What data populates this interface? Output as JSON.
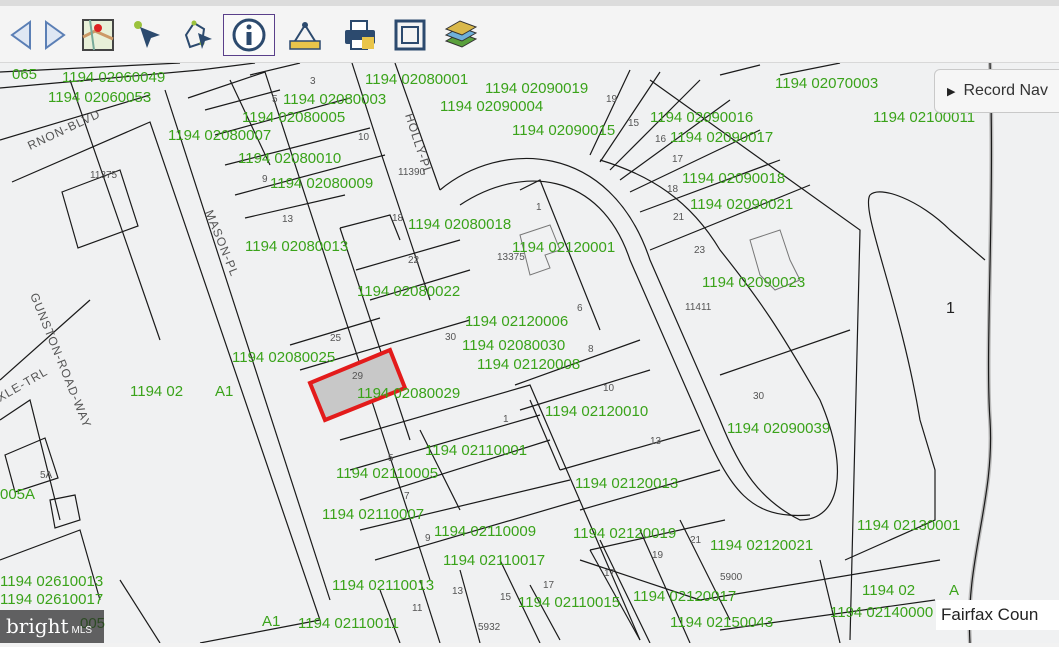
{
  "toolbar": {
    "items": [
      {
        "name": "back-arrow-icon"
      },
      {
        "name": "forward-arrow-icon"
      },
      {
        "name": "map-locate-icon"
      },
      {
        "name": "select-pointer-icon"
      },
      {
        "name": "select-polygon-icon"
      },
      {
        "name": "identify-info-icon"
      },
      {
        "name": "measure-icon"
      },
      {
        "name": "print-icon"
      },
      {
        "name": "full-extent-icon"
      },
      {
        "name": "layers-icon"
      }
    ],
    "active": "identify-info-icon"
  },
  "record_nav": {
    "label": "Record Nav"
  },
  "footer": {
    "county": "Fairfax Coun"
  },
  "logo": {
    "text": "bright",
    "suffix": "MLS"
  },
  "colors": {
    "parcel_label": "#3aa31a",
    "line": "#1a1a1a",
    "selected": "#e31b1b",
    "road_fill": "#f0f1f2"
  },
  "map": {
    "parcel_labels": [
      {
        "text": "1194 02060049"
      },
      {
        "text": "1194 02060053"
      },
      {
        "text": "1194 02080001"
      },
      {
        "text": "1194 02090019"
      },
      {
        "text": "1194 02090004"
      },
      {
        "text": "1194 02070003"
      },
      {
        "text": "1194 02080003"
      },
      {
        "text": "1194 02080007"
      },
      {
        "text": "1194 02080005"
      },
      {
        "text": "1194 02090015"
      },
      {
        "text": "1194 02090016"
      },
      {
        "text": "1194 02090017"
      },
      {
        "text": "1194 02100011"
      },
      {
        "text": "1194 02080010"
      },
      {
        "text": "1194 02080009"
      },
      {
        "text": "1194 02090018"
      },
      {
        "text": "1194 02090021"
      },
      {
        "text": "1194 02080018"
      },
      {
        "text": "1194 02080013"
      },
      {
        "text": "1194 02120001"
      },
      {
        "text": "1194 02080022"
      },
      {
        "text": "1194 02090023"
      },
      {
        "text": "1194 02120006"
      },
      {
        "text": "1194 02080030"
      },
      {
        "text": "1194 02080025"
      },
      {
        "text": "1194 02120008"
      },
      {
        "text": "1194 02"
      },
      {
        "text": "A1"
      },
      {
        "text": "1194 02080029"
      },
      {
        "text": "1194 02120010"
      },
      {
        "text": "1194 02090039"
      },
      {
        "text": "1194 02110001"
      },
      {
        "text": "1194 02110005"
      },
      {
        "text": "1194 02120013"
      },
      {
        "text": "1194 02110007"
      },
      {
        "text": "1194 02110009"
      },
      {
        "text": "1194 02120019"
      },
      {
        "text": "1194 02120021"
      },
      {
        "text": "1194 02130001"
      },
      {
        "text": "1194 02110017"
      },
      {
        "text": "1194 02610013"
      },
      {
        "text": "1194 02110013"
      },
      {
        "text": "1194 02"
      },
      {
        "text": "A"
      },
      {
        "text": "1194 02610017"
      },
      {
        "text": "1194 02110015"
      },
      {
        "text": "1194 02120017"
      },
      {
        "text": "1194 02140000"
      },
      {
        "text": "A1"
      },
      {
        "text": "1194 02110011"
      },
      {
        "text": "1194 02150043"
      },
      {
        "text": "005A"
      },
      {
        "text": "065"
      },
      {
        "text": "005"
      }
    ],
    "lot_numbers": [
      "3",
      "5",
      "10",
      "9",
      "13",
      "18",
      "22",
      "1",
      "19",
      "15",
      "16",
      "17",
      "18",
      "21",
      "23",
      "25",
      "30",
      "6",
      "29",
      "8",
      "10",
      "13",
      "30",
      "1",
      "5",
      "7",
      "9",
      "11",
      "13",
      "15",
      "17",
      "17",
      "19",
      "21",
      "11375",
      "13375",
      "11411",
      "11390",
      "5A",
      "5900",
      "5932",
      "1"
    ],
    "street_labels": [
      {
        "text": "RNON-BLVD"
      },
      {
        "text": "MASON-PL"
      },
      {
        "text": "HOLLY-PL"
      },
      {
        "text": "GUNSTON-ROAD-WAY"
      },
      {
        "text": "XLE-TRL"
      }
    ],
    "selected_parcel": {
      "lot": "29",
      "label": "1194 02080029"
    }
  }
}
